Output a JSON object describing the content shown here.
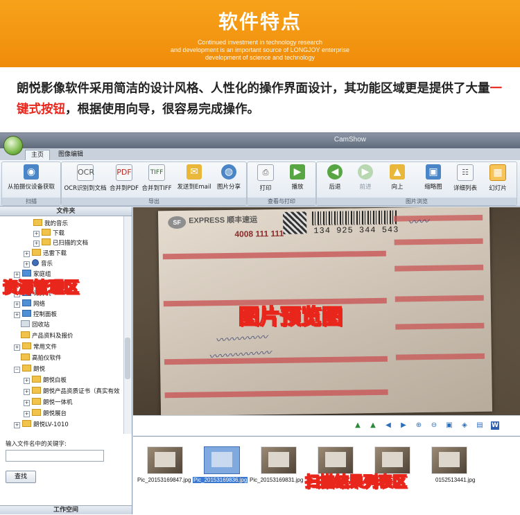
{
  "banner": {
    "title": "软件特点",
    "subtitle_lines": [
      "Continued investment in technology research",
      "and development is an important source of LONGJOY enterprise",
      "development of science and technology"
    ]
  },
  "intro": {
    "text_before": "朗悦影像软件采用简洁的设计风格、人性化的操作界面设计，其功能区域更是提供了大量",
    "highlight": "一键式按钮",
    "text_after": "，根据使用向导，很容易完成操作。",
    "highlight_color": "#e8261c"
  },
  "app": {
    "window_title": "CamShow",
    "tabs": [
      "主页",
      "图像编辑"
    ],
    "groups": [
      "扫描",
      "导出",
      "查看与打印",
      "图片浏览"
    ],
    "buttons": {
      "capture": "从拍摄仪设备获取",
      "ocr": "OCR识别到文档",
      "merge_pdf": "合并到PDF",
      "merge_tiff": "合并到TIFF",
      "send_email": "发送到Email",
      "share": "图片分享",
      "print": "打印",
      "play": "播放",
      "back": "后退",
      "forward": "前进",
      "up": "向上",
      "thumbnail": "缩略图",
      "detail_list": "详细列表",
      "slideshow": "幻灯片"
    },
    "icons": {
      "ocr": "OCR",
      "pdf": "PDF",
      "tiff": "TIFF"
    },
    "folder_panel": {
      "title": "文件夹",
      "items": [
        "我的音乐",
        "下载",
        "已扫描的文档",
        "迅雷下载",
        "音乐",
        "家庭组",
        "计算机",
        "网络",
        "控制面板",
        "回收站",
        "产品资料及报价",
        "常用文件",
        "高拍仪软件",
        "朗悦",
        "朗悦白板",
        "朗悦产品资质证书（真实有效",
        "朗悦一体机",
        "朗悦展台",
        "朗悦LV-1010"
      ],
      "keyword_label": "输入文件名中的关键字:",
      "keyword_value": "",
      "search_button": "查找",
      "workspace": "工作空间"
    },
    "preview_doc": {
      "sf": "SF",
      "express": "EXPRESS 顺丰速运",
      "phone": "4008 111 111",
      "tracking": "134 925 344 543"
    },
    "thumbnails": [
      "Pic_20153169847.jpg",
      "Pic_20153169836.jpg",
      "Pic_20153169831.jpg",
      "",
      "",
      "0152513441.jpg"
    ],
    "selected_thumbnail_index": 1
  },
  "callouts": {
    "resource": "资源管理区",
    "preview": "图片预览图",
    "scan_list": "扫描结果列表区"
  }
}
